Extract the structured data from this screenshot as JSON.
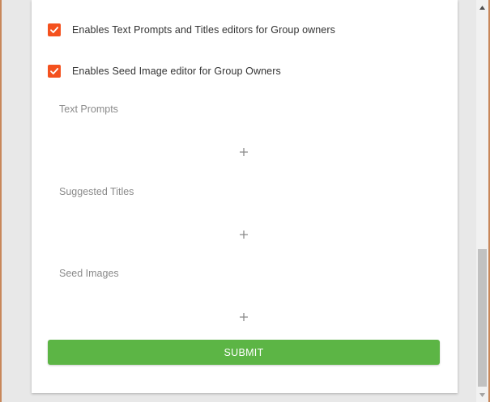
{
  "options": [
    {
      "label": "Enables Text Prompts and Titles editors for Group owners",
      "checked": true
    },
    {
      "label": "Enables Seed Image editor for Group Owners",
      "checked": true
    }
  ],
  "sections": [
    {
      "label": "Text Prompts",
      "add_icon": "plus-icon"
    },
    {
      "label": "Suggested Titles",
      "add_icon": "plus-icon"
    },
    {
      "label": "Seed Images",
      "add_icon": "plus-icon"
    }
  ],
  "submit": {
    "label": "SUBMIT"
  },
  "colors": {
    "checkbox": "#f4511e",
    "submit": "#5cb545",
    "frame_border": "#c8875a"
  }
}
